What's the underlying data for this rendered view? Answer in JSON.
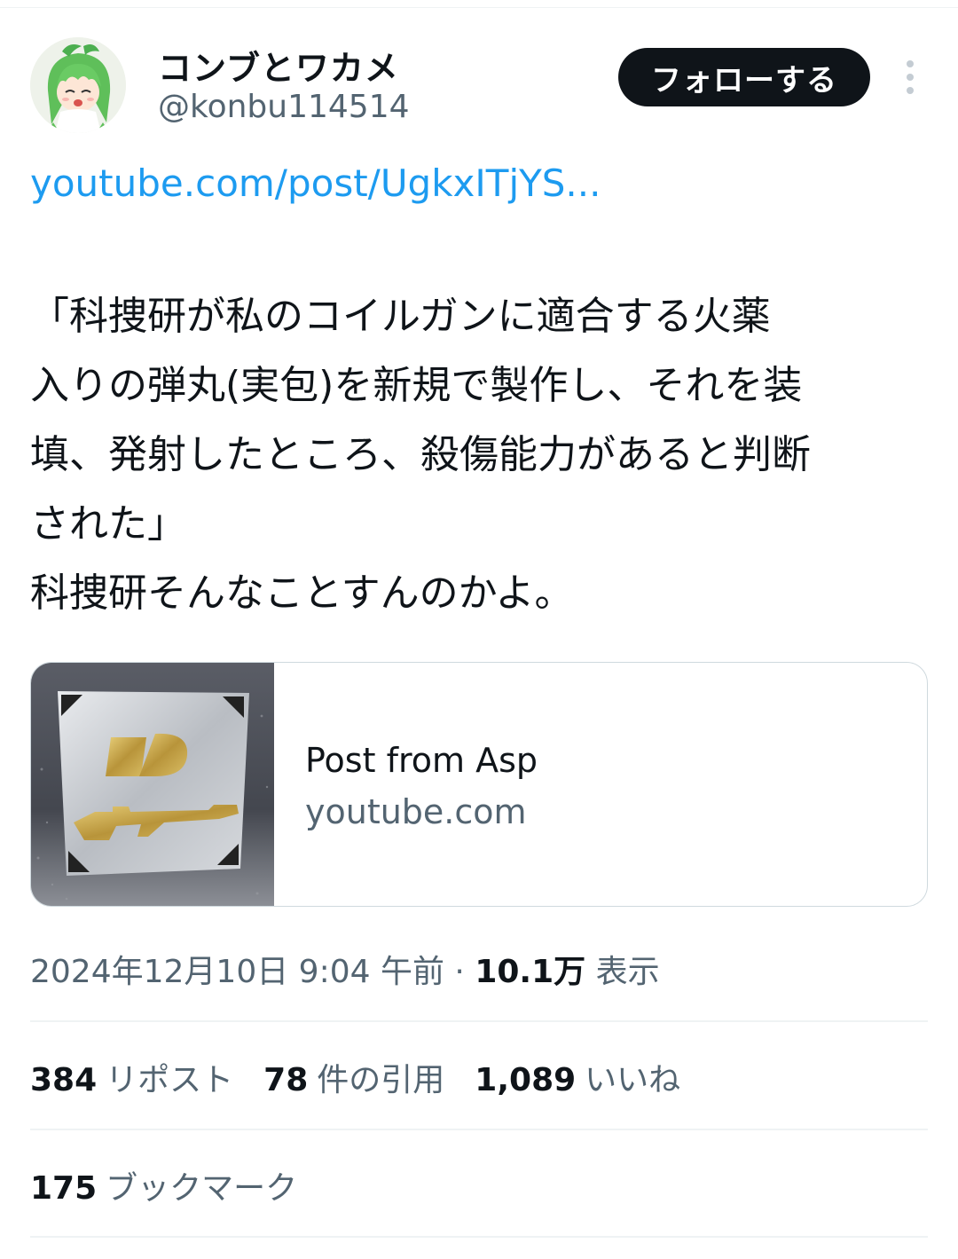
{
  "header": {
    "display_name": "コンブとワカメ",
    "handle": "@konbu114514",
    "follow_label": "フォローする"
  },
  "post": {
    "link_text": "youtube.com/post/UgkxITjYS...",
    "text_lines": [
      "「科捜研が私のコイルガンに適合する火薬",
      "入りの弾丸(実包)を新規で製作し、それを装",
      "填、発射したところ、殺傷能力があると判断",
      "された」",
      "科捜研そんなことすんのかよ。"
    ]
  },
  "card": {
    "title": "Post from Asp",
    "domain": "youtube.com"
  },
  "meta": {
    "timestamp": "2024年12月10日 9:04 午前",
    "separator": " · ",
    "views_count": "10.1万",
    "views_label": " 表示"
  },
  "stats": {
    "reposts": {
      "count": "384",
      "label": "リポスト"
    },
    "quotes": {
      "count": "78",
      "label": "件の引用"
    },
    "likes": {
      "count": "1,089",
      "label": "いいね"
    },
    "bookmarks": {
      "count": "175",
      "label": "ブックマーク"
    }
  },
  "icons": {
    "more": "more-options-icon",
    "avatar": "green-haired-character-avatar"
  },
  "colors": {
    "link": "#1d9bf0",
    "text_primary": "#0f1419",
    "text_secondary": "#536471",
    "follow_bg": "#0f1419",
    "divider": "#eff3f4"
  }
}
